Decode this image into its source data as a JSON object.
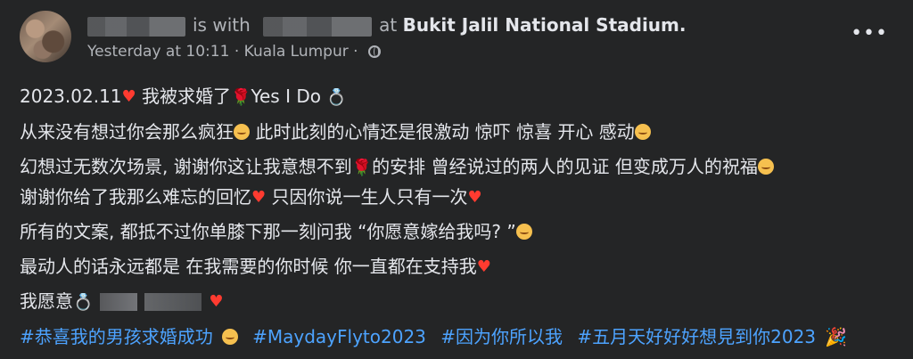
{
  "header": {
    "with_text": "is with",
    "at_text": "at",
    "location": "Bukit Jalil National Stadium.",
    "time": "Yesterday at 10:11",
    "separator": "·",
    "city": "Kuala Lumpur",
    "meta_separator": "·",
    "more_label": "•••"
  },
  "post": {
    "line1_text": "2023.02.11",
    "line1_middle": "我被求婚了",
    "line1_end": "Yes I Do",
    "line2_text": "从来没有想过你会那么疯狂",
    "line2_end": "此时此刻的心情还是很激动 惊吓 惊喜 开心 感动",
    "line3_text": "幻想过无数次场景, 谢谢你这让我意想不到",
    "line3_end": "的安排 曾经说过的两人的见证 但变成万人的祝福",
    "line4_text": "谢谢你给了我那么难忘的回忆",
    "line4_end": "只因你说一生人只有一次",
    "line5_text": "所有的文案, 都抵不过你单膝下那一刻问我 “你愿意嫁给我吗? ”",
    "line6_text": "最动人的话永远都是 在我需要的你时候 你一直都在支持我",
    "line7_text": "我愿意"
  },
  "hashtags": [
    "#恭喜我的男孩求婚成功",
    "#MaydayFlyto2023",
    "#因为你所以我",
    "#五月天好好好想見到你2023"
  ],
  "icons": {
    "heart": "♥",
    "rose": "🌹",
    "ring": "💍",
    "party": "🎉"
  }
}
